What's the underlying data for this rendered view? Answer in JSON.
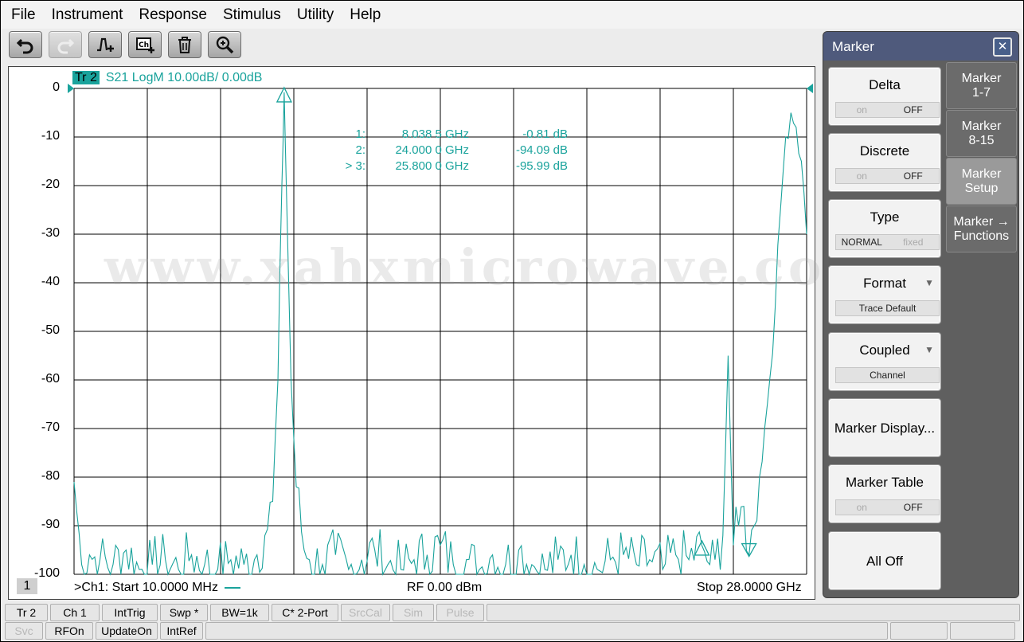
{
  "menu": [
    "File",
    "Instrument",
    "Response",
    "Stimulus",
    "Utility",
    "Help"
  ],
  "toolbar": {
    "buttons": [
      {
        "icon": "undo-icon",
        "enabled": true
      },
      {
        "icon": "redo-icon",
        "enabled": false
      },
      {
        "icon": "add-trace-icon",
        "enabled": true
      },
      {
        "icon": "add-channel-icon",
        "enabled": true
      },
      {
        "icon": "delete-icon",
        "enabled": true
      },
      {
        "icon": "zoom-icon",
        "enabled": true
      }
    ]
  },
  "plot": {
    "trace_tag": "Tr 2",
    "trace_info": "S21 LogM 10.00dB/  0.00dB",
    "watermark": "www.xahxmicrowave.com",
    "footer": {
      "channel_number": "1",
      "start": ">Ch1:  Start  10.0000 MHz",
      "rf": "RF    0.00 dBm",
      "stop": "Stop  28.0000 GHz"
    },
    "markers": [
      {
        "label": "1:",
        "freq": "8.038 5 GHz",
        "value": "-0.81 dB"
      },
      {
        "label": "2:",
        "freq": "24.000 0 GHz",
        "value": "-94.09 dB"
      },
      {
        "label": "> 3:",
        "freq": "25.800 0 GHz",
        "value": "-95.99 dB"
      }
    ]
  },
  "chart_data": {
    "type": "line",
    "xlabel": "",
    "ylabel": "",
    "xlim": [
      0.01,
      28.0
    ],
    "ylim": [
      -100,
      0
    ],
    "x_unit": "GHz",
    "y_unit": "dB",
    "y_ticks": [
      "0",
      "-10",
      "-20",
      "-30",
      "-40",
      "-50",
      "-60",
      "-70",
      "-80",
      "-90",
      "-100"
    ],
    "grid": true,
    "series": [
      {
        "x": [
          0.01,
          0.3,
          0.6,
          1.0,
          1.5,
          2.0,
          2.5,
          3.0,
          3.5,
          4.0,
          4.5,
          5.0,
          5.5,
          6.0,
          6.5,
          7.0,
          7.3,
          7.6,
          7.8,
          7.95,
          8.0385,
          8.12,
          8.3,
          8.5,
          8.8,
          9.0,
          9.5,
          10.0,
          10.5,
          11.0,
          11.5,
          12.0,
          12.5,
          13.0,
          13.5,
          14.0,
          14.5,
          15.0,
          15.5,
          16.0,
          16.5,
          17.0,
          17.5,
          18.0,
          18.5,
          19.0,
          19.5,
          20.0,
          20.5,
          21.0,
          21.5,
          22.0,
          22.5,
          23.0,
          23.5,
          24.0,
          24.3,
          24.5,
          24.8,
          25.0,
          25.2,
          25.4,
          25.6,
          25.8,
          26.0,
          26.2,
          26.5,
          26.8,
          27.0,
          27.2,
          27.4,
          27.6,
          27.8,
          28.0
        ],
        "y": [
          -81,
          -98,
          -96,
          -97,
          -98,
          -95,
          -99,
          -98,
          -97,
          -99,
          -96,
          -98,
          -99,
          -97,
          -98,
          -96,
          -92,
          -85,
          -60,
          -20,
          -0.81,
          -20,
          -60,
          -82,
          -95,
          -97,
          -98,
          -96,
          -99,
          -97,
          -95,
          -98,
          -99,
          -97,
          -96,
          -94,
          -98,
          -97,
          -99,
          -96,
          -98,
          -95,
          -98,
          -99,
          -97,
          -96,
          -98,
          -99,
          -97,
          -96,
          -98,
          -97,
          -99,
          -96,
          -97,
          -94.09,
          -98,
          -97,
          -92,
          -55,
          -94,
          -90,
          -86,
          -95.99,
          -90,
          -80,
          -65,
          -45,
          -25,
          -10,
          -5,
          -8,
          -15,
          -30
        ]
      }
    ]
  },
  "panel": {
    "title": "Marker",
    "softkeys": [
      {
        "label": "Delta",
        "toggle": [
          "on",
          "OFF"
        ],
        "active": 1
      },
      {
        "label": "Discrete",
        "toggle": [
          "on",
          "OFF"
        ],
        "active": 1
      },
      {
        "label": "Type",
        "toggle": [
          "NORMAL",
          "fixed"
        ],
        "active": 0
      },
      {
        "label": "Format",
        "value": "Trace Default",
        "dropdown": true
      },
      {
        "label": "Coupled",
        "value": "Channel",
        "dropdown": true
      },
      {
        "label": "Marker Display..."
      },
      {
        "label": "Marker Table",
        "toggle": [
          "on",
          "OFF"
        ],
        "active": 1
      },
      {
        "label": "All Off"
      }
    ],
    "tabs": [
      {
        "label": "Marker\n1-7"
      },
      {
        "label": "Marker\n8-15"
      },
      {
        "label": "Marker\nSetup",
        "active": true
      },
      {
        "label": "Marker →\nFunctions"
      }
    ]
  },
  "status_row1": [
    {
      "label": "Tr 2",
      "enabled": true
    },
    {
      "label": "Ch 1",
      "enabled": true
    },
    {
      "label": "IntTrig",
      "enabled": true
    },
    {
      "label": "Swp *",
      "enabled": true
    },
    {
      "label": "BW=1k",
      "enabled": true
    },
    {
      "label": "C* 2-Port",
      "enabled": true
    },
    {
      "label": "SrcCal",
      "enabled": false
    },
    {
      "label": "Sim",
      "enabled": false
    },
    {
      "label": "Pulse",
      "enabled": false
    }
  ],
  "status_row2": [
    {
      "label": "Svc",
      "enabled": false
    },
    {
      "label": "RFOn",
      "enabled": true
    },
    {
      "label": "UpdateOn",
      "enabled": true
    },
    {
      "label": "IntRef",
      "enabled": true
    }
  ],
  "colors": {
    "trace": "#1aa39c",
    "panel_title": "#4f5a7c"
  }
}
